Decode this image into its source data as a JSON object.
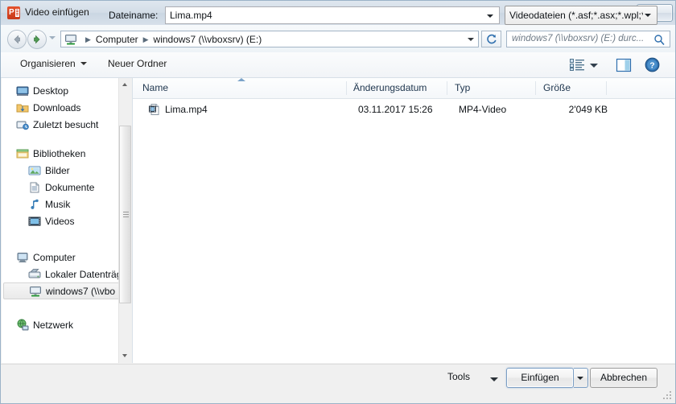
{
  "window": {
    "title": "Video einfügen",
    "app_icon": "powerpoint-icon",
    "close_label": "✕"
  },
  "navbar": {
    "back_icon": "back-arrow-icon",
    "forward_icon": "forward-arrow-icon",
    "history_dropdown_icon": "chevron-down-icon",
    "address_icon": "network-drive-icon",
    "breadcrumbs": [
      "Computer",
      "windows7 (\\\\vboxsrv) (E:)"
    ],
    "address_dropdown_icon": "chevron-down-icon",
    "refresh_icon": "refresh-icon",
    "search_placeholder": "windows7 (\\\\vboxsrv) (E:) durc...",
    "search_icon": "search-icon"
  },
  "toolbar": {
    "organize_label": "Organisieren",
    "new_folder_label": "Neuer Ordner",
    "view_icon": "list-view-icon",
    "view_dropdown_icon": "chevron-down-icon",
    "preview_pane_icon": "preview-pane-icon",
    "help_icon": "help-icon"
  },
  "sidebar": {
    "items": [
      {
        "label": "Desktop",
        "icon": "desktop-icon",
        "level": 0,
        "selected": false
      },
      {
        "label": "Downloads",
        "icon": "downloads-folder-icon",
        "level": 0,
        "selected": false
      },
      {
        "label": "Zuletzt besucht",
        "icon": "recent-places-icon",
        "level": 0,
        "selected": false
      },
      {
        "label": "Bibliotheken",
        "icon": "libraries-icon",
        "level": 0,
        "selected": false
      },
      {
        "label": "Bilder",
        "icon": "pictures-icon",
        "level": 1,
        "selected": false
      },
      {
        "label": "Dokumente",
        "icon": "documents-icon",
        "level": 1,
        "selected": false
      },
      {
        "label": "Musik",
        "icon": "music-icon",
        "level": 1,
        "selected": false
      },
      {
        "label": "Videos",
        "icon": "videos-icon",
        "level": 1,
        "selected": false
      },
      {
        "label": "Computer",
        "icon": "computer-icon",
        "level": 0,
        "selected": false
      },
      {
        "label": "Lokaler Datenträg",
        "icon": "hard-disk-icon",
        "level": 1,
        "selected": false
      },
      {
        "label": "windows7 (\\\\vbo",
        "icon": "network-drive-icon",
        "level": 1,
        "selected": true
      },
      {
        "label": "Netzwerk",
        "icon": "network-icon",
        "level": 0,
        "selected": false
      }
    ],
    "scrollbar": {
      "up_icon": "scroll-up-icon",
      "down_icon": "scroll-down-icon"
    }
  },
  "filelist": {
    "columns": [
      "Name",
      "Änderungsdatum",
      "Typ",
      "Größe"
    ],
    "sort_column": "Name",
    "sort_direction": "ascending",
    "rows": [
      {
        "name": "Lima.mp4",
        "modified": "03.11.2017 15:26",
        "type": "MP4-Video",
        "size": "2'049 KB",
        "icon": "video-file-icon"
      }
    ]
  },
  "bottom": {
    "filename_label": "Dateiname:",
    "filename_value": "Lima.mp4",
    "filename_dropdown_icon": "chevron-down-icon",
    "filter_value": "Videodateien (*.asf;*.asx;*.wpl;*",
    "filter_dropdown_icon": "chevron-down-icon",
    "tools_label": "Tools",
    "tools_dropdown_icon": "chevron-down-icon",
    "insert_label": "Einfügen",
    "insert_dropdown_icon": "chevron-down-icon",
    "cancel_label": "Abbrechen"
  },
  "colors": {
    "titlebar": "#d3dde7",
    "accent_blue": "#7ba3c9",
    "window_bg": "#f0f0f0",
    "powerpoint_red": "#d3452a"
  }
}
